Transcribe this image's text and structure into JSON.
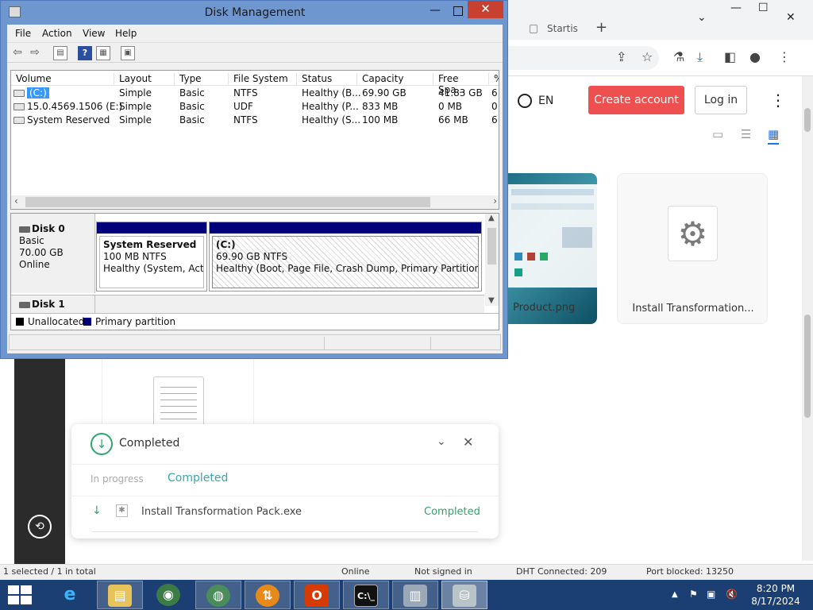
{
  "browser": {
    "tab_label": "Startis",
    "tab_plus": "+",
    "win_controls": {
      "dropdown": "⌄",
      "minimize": "—",
      "maximize": "☐",
      "close": "✕"
    },
    "toolbar_icons": [
      "share-icon",
      "star-icon",
      "flask-icon",
      "download-icon",
      "sidebar-icon",
      "profile-icon",
      "kebab-icon"
    ],
    "header": {
      "language": "EN",
      "create_account": "Create account",
      "log_in": "Log in",
      "more": "⋮"
    },
    "view_icons": [
      "image-view-icon",
      "list-view-icon",
      "grid-view-icon"
    ],
    "cards": [
      {
        "label": "Product.png"
      },
      {
        "label": "Install Transformation..."
      }
    ]
  },
  "download_panel": {
    "title": "Completed",
    "tabs": {
      "in_progress": "In progress",
      "completed": "Completed"
    },
    "item": {
      "filename": "Install Transformation Pack.exe",
      "status": "Completed"
    },
    "colors": {
      "accent": "#2fa56a",
      "tab_active": "#38a6b0"
    }
  },
  "status_strip": {
    "selection": "1 selected / 1 in total",
    "online": "Online",
    "signed": "Not signed in",
    "dht": "DHT Connected: 209",
    "port": "Port blocked: 13250"
  },
  "disk_management": {
    "title": "Disk Management",
    "menu": [
      "File",
      "Action",
      "View",
      "Help"
    ],
    "columns": [
      "Volume",
      "Layout",
      "Type",
      "File System",
      "Status",
      "Capacity",
      "Free Spa...",
      "%"
    ],
    "volumes": [
      {
        "volume": "(C:)",
        "layout": "Simple",
        "type": "Basic",
        "fs": "NTFS",
        "status": "Healthy (B...",
        "capacity": "69.90 GB",
        "free": "41.83 GB",
        "pct": "6"
      },
      {
        "volume": "15.0.4569.1506 (E:)",
        "layout": "Simple",
        "type": "Basic",
        "fs": "UDF",
        "status": "Healthy (P...",
        "capacity": "833 MB",
        "free": "0 MB",
        "pct": "0"
      },
      {
        "volume": "System Reserved",
        "layout": "Simple",
        "type": "Basic",
        "fs": "NTFS",
        "status": "Healthy (S...",
        "capacity": "100 MB",
        "free": "66 MB",
        "pct": "6"
      }
    ],
    "disk0": {
      "name": "Disk 0",
      "kind": "Basic",
      "size": "70.00 GB",
      "state": "Online",
      "partitions": [
        {
          "name": "System Reserved",
          "detail": "100 MB NTFS",
          "health": "Healthy (System, Active, Primary Partition)"
        },
        {
          "name": "(C:)",
          "detail": "69.90 GB NTFS",
          "health": "Healthy (Boot, Page File, Crash Dump, Primary Partition)"
        }
      ]
    },
    "disk1": {
      "name": "Disk 1"
    },
    "legend": [
      {
        "label": "Unallocated",
        "color": "#000000"
      },
      {
        "label": "Primary partition",
        "color": "#00007a"
      }
    ]
  },
  "taskbar": {
    "apps": [
      "ie-icon",
      "file-explorer-icon",
      "network-globe-icon",
      "globe-icon",
      "torrent-client-icon",
      "office-icon",
      "command-prompt-icon",
      "server-manager-icon",
      "disk-management-icon"
    ],
    "clock": {
      "time": "8:20 PM",
      "date": "8/17/2024"
    }
  }
}
